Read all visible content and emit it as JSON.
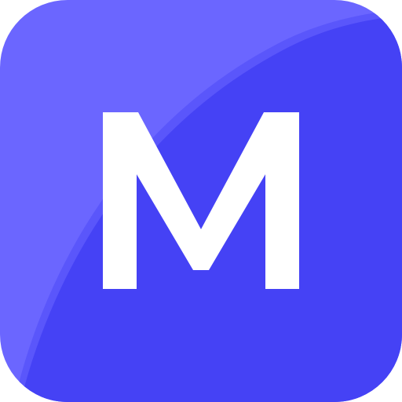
{
  "icon": {
    "name": "letter-m-app-icon",
    "letter": "M",
    "colors": {
      "background_light": "#6B66FF",
      "background_dark": "#4542F5",
      "highlight_edge": "#5A56FB",
      "glyph": "#FFFFFF"
    }
  }
}
